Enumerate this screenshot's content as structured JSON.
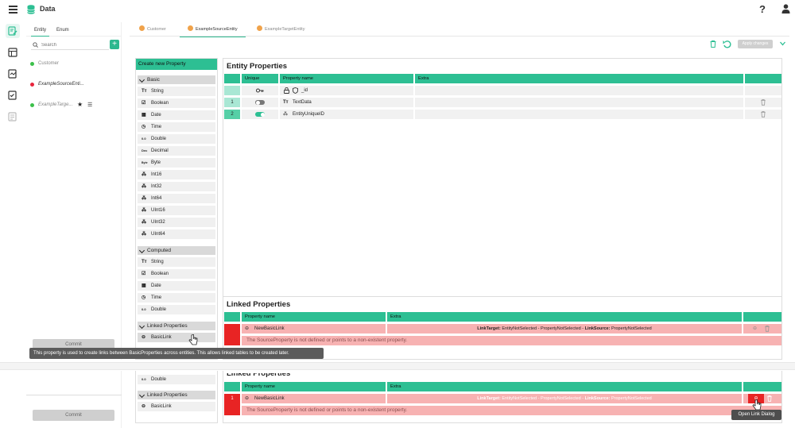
{
  "app": {
    "title": "Data"
  },
  "header": {
    "help": "?"
  },
  "entity_panel": {
    "tabs": [
      "Entity",
      "Enum"
    ],
    "search_placeholder": "Search",
    "add_label": "+",
    "entities": [
      {
        "name": "Customer",
        "dot_color": "#3cc04a"
      },
      {
        "name": "ExampleSourceEnti...",
        "dot_color": "#e8253d"
      },
      {
        "name": "ExampleTarge...",
        "dot_color": "#3cc04a"
      }
    ],
    "commit_label": "Commit"
  },
  "main_tabs": [
    "Customer",
    "ExampleSourceEntity",
    "ExampleTargetEntity"
  ],
  "toolbar": {
    "apply_label": "Apply changes"
  },
  "palette": {
    "header": "Create new Property",
    "groups": [
      {
        "name": "Basic",
        "items": [
          {
            "label": "String",
            "icon": "Tт"
          },
          {
            "label": "Boolean",
            "icon": "☑"
          },
          {
            "label": "Date",
            "icon": "▦"
          },
          {
            "label": "Time",
            "icon": "◷"
          },
          {
            "label": "Double",
            "icon": "0.0"
          },
          {
            "label": "Decimal",
            "icon": "Dec"
          },
          {
            "label": "Byte",
            "icon": "Byte"
          },
          {
            "label": "Int16",
            "icon": "⁂"
          },
          {
            "label": "Int32",
            "icon": "⁂"
          },
          {
            "label": "Int64",
            "icon": "⁂"
          },
          {
            "label": "UInt16",
            "icon": "⁂"
          },
          {
            "label": "UInt32",
            "icon": "⁂"
          },
          {
            "label": "UInt64",
            "icon": "⁂"
          }
        ]
      },
      {
        "name": "Computed",
        "items": [
          {
            "label": "String",
            "icon": "Tт"
          },
          {
            "label": "Boolean",
            "icon": "☑"
          },
          {
            "label": "Date",
            "icon": "▦"
          },
          {
            "label": "Time",
            "icon": "◷"
          },
          {
            "label": "Double",
            "icon": "0.0"
          }
        ]
      },
      {
        "name": "Linked Properties",
        "items": [
          {
            "label": "BasicLink",
            "icon": "⊖"
          }
        ]
      }
    ]
  },
  "entity_properties": {
    "title": "Entity Properties",
    "columns": [
      "Unique",
      "Property name",
      "Extra"
    ],
    "rows": [
      {
        "index": "",
        "name": "_id",
        "unique": "key"
      },
      {
        "index": "1",
        "name": "TextData",
        "unique": "off"
      },
      {
        "index": "2",
        "name": "EntityUniqueID",
        "unique": "on"
      }
    ]
  },
  "linked_properties": {
    "title": "Linked Properties",
    "columns": [
      "Property name",
      "Extra"
    ],
    "rows": [
      {
        "index": "1",
        "name": "NewBasicLink",
        "extra_target_label": "LinkTarget:",
        "extra_target_value": "EntityNotSelected - PropertyNotSelected -",
        "extra_source_label": "LinkSource:",
        "extra_source_value": "PropertyNotSelected",
        "error": "The SourceProperty is not defined or points to a non-existent property."
      }
    ]
  },
  "tooltips": {
    "basic_link": "This property is used to create links between BasicProperties across entities. This allows linked tables to be created later.",
    "open_link": "Open Link Dialog"
  },
  "colors": {
    "accent": "#2dbf93",
    "error": "#e82424",
    "error_bg": "#f7b2b2"
  }
}
